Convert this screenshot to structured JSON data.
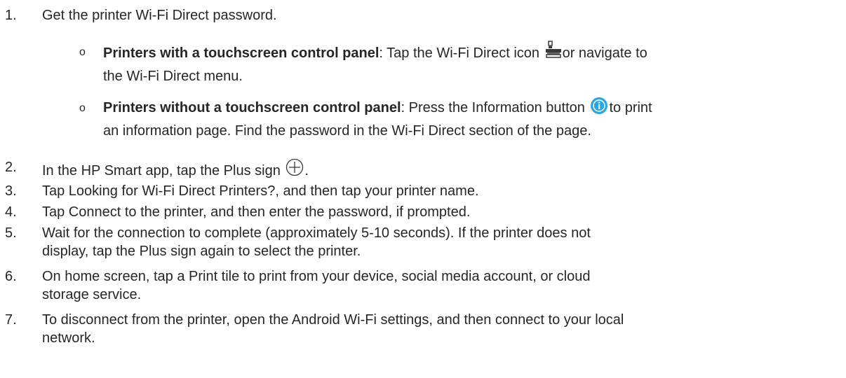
{
  "steps": [
    {
      "num": "1.",
      "text": "Get the printer Wi-Fi Direct password."
    },
    {
      "num": "2.",
      "text_before": "In the HP Smart app, tap the Plus sign",
      "text_after": "."
    },
    {
      "num": "3.",
      "text": "Tap Looking for Wi-Fi Direct Printers?, and then tap your printer name."
    },
    {
      "num": "4.",
      "text": "Tap Connect to the printer, and then enter the password, if prompted."
    },
    {
      "num": "5.",
      "line1": "Wait for the connection to complete (approximately 5-10 seconds). If the printer does not",
      "line2": "display, tap the Plus sign again to select the printer."
    },
    {
      "num": "6.",
      "line1": "On home screen, tap a Print tile to print from your device, social media account, or cloud",
      "line2": "storage service."
    },
    {
      "num": "7.",
      "line1": "To disconnect from the printer, open the Android Wi-Fi settings, and then connect to your local",
      "line2": "network."
    }
  ],
  "sub_items": [
    {
      "bullet": "o",
      "bold": "Printers with a touchscreen control panel",
      "line1_rest": ": Tap the Wi-Fi Direct icon",
      "line1_after": "or navigate to",
      "line2": "the Wi-Fi Direct menu.",
      "icon": "wifi-direct-icon"
    },
    {
      "bullet": "o",
      "bold": "Printers without a touchscreen control panel",
      "line1_rest": ": Press the Information button",
      "line1_after": "to print",
      "line2": "an information page. Find the password in the Wi-Fi Direct section of the page.",
      "icon": "information-icon"
    }
  ],
  "icons": {
    "plus": "plus-circle-icon",
    "info_color": "#2aa7e0",
    "wifi_direct_color": "#3a3a3a"
  }
}
